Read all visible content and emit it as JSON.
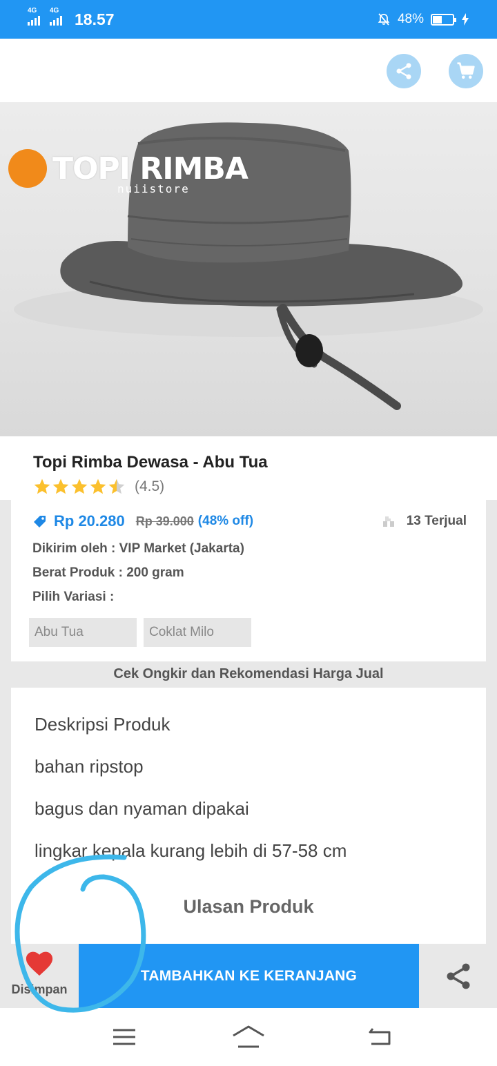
{
  "status_bar": {
    "network1": "4G",
    "network2": "4G",
    "time": "18.57",
    "battery": "48%",
    "battery_level": 0.48
  },
  "toolbar": {
    "share_icon": "share-icon",
    "cart_icon": "cart-icon"
  },
  "image": {
    "watermark_title": "TOPI RIMBA",
    "watermark_sub": "nuiistore",
    "logo_text": "nuiistore"
  },
  "product": {
    "title": "Topi Rimba Dewasa - Abu Tua",
    "rating": "(4.5)",
    "rating_value": 4.5,
    "price": "Rp 20.280",
    "old_price": "Rp 39.000",
    "discount": "(48% off)",
    "sold": "13 Terjual",
    "shipper": "Dikirim oleh : VIP Market (Jakarta)",
    "weight": "Berat Produk : 200 gram",
    "variant_label": "Pilih Variasi :",
    "variants": [
      "Abu Tua",
      "Coklat Milo"
    ]
  },
  "ongkir_link": "Cek Ongkir dan Rekomendasi Harga Jual",
  "description": {
    "lines": [
      "Deskripsi Produk",
      "bahan ripstop",
      "bagus dan nyaman dipakai",
      "lingkar kepala kurang lebih di 57-58 cm"
    ],
    "reviews_title": "Ulasan Produk"
  },
  "actions": {
    "save_label": "Disimpan",
    "add_to_cart": "TAMBAHKAN KE KERANJANG"
  },
  "colors": {
    "primary": "#2196f3",
    "star": "#fbc02d",
    "heart": "#e53935"
  }
}
